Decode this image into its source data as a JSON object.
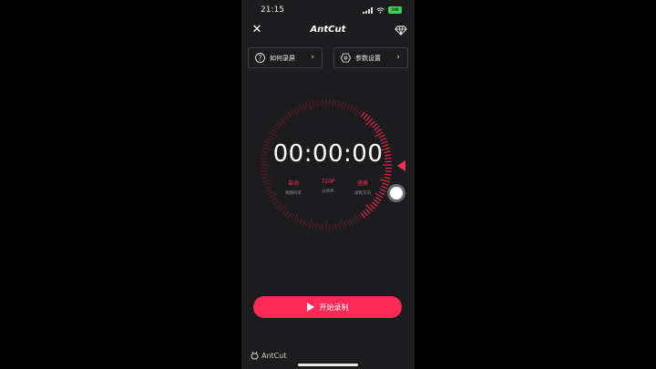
{
  "status_bar": {
    "time": "21:15",
    "battery": "100"
  },
  "header": {
    "brand": "AntCut",
    "close_icon": "close-icon",
    "vip_icon": "diamond-icon"
  },
  "cards": [
    {
      "label": "如何录屏",
      "icon": "question-icon"
    },
    {
      "label": "参数设置",
      "icon": "settings-hexagon-icon"
    }
  ],
  "timer": {
    "display": "00:00:00"
  },
  "params": [
    {
      "value": "自动",
      "label": "视频码率"
    },
    {
      "value": "720P",
      "label": "分辨率"
    },
    {
      "value": "竖屏",
      "label": "录制方向"
    }
  ],
  "start_button": {
    "label": "开始录制"
  },
  "footer": {
    "brand": "AntCut"
  },
  "colors": {
    "accent": "#ff2d55",
    "background": "#1c1c1f",
    "dial_dim": "#5a1a28"
  }
}
